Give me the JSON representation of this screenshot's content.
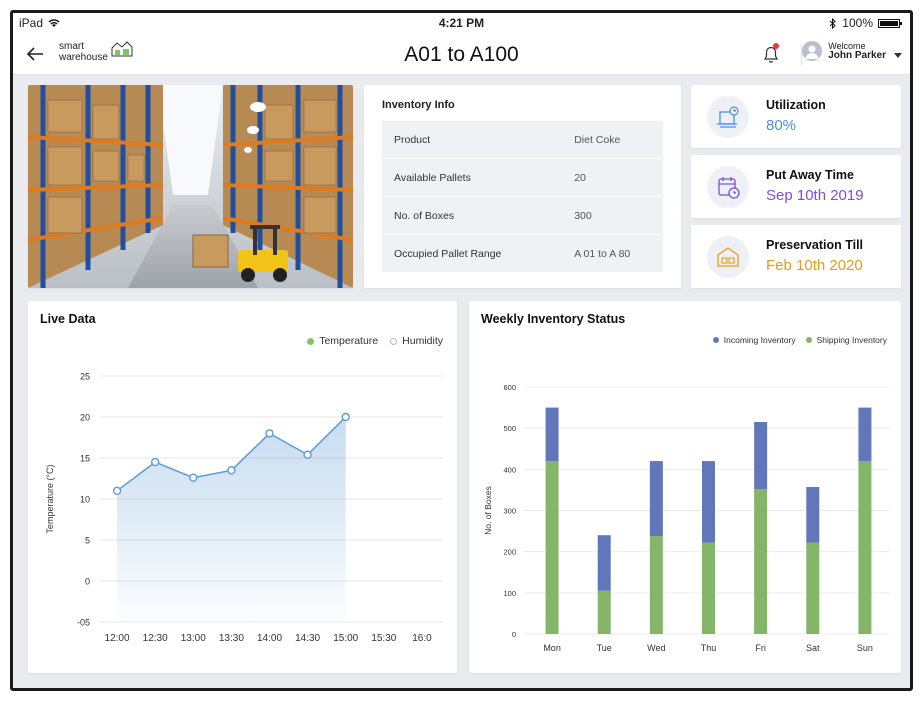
{
  "status_bar": {
    "device": "iPad",
    "time": "4:21 PM",
    "battery": "100%",
    "battery_level": 1.0
  },
  "header": {
    "logo_line1": "smart",
    "logo_line2": "warehouse",
    "title": "A01 to A100",
    "welcome": "Welcome",
    "user_name": "John Parker"
  },
  "inventory": {
    "title": "Inventory Info",
    "rows": [
      {
        "label": "Product",
        "value": "Diet Coke"
      },
      {
        "label": "Available Pallets",
        "value": "20"
      },
      {
        "label": "No. of Boxes",
        "value": "300"
      },
      {
        "label": "Occupied Pallet Range",
        "value": "A 01 to A 80"
      }
    ]
  },
  "stats": [
    {
      "label": "Utilization",
      "value": "80%",
      "color": "#4a90e2",
      "icon": "cart-icon"
    },
    {
      "label": "Put Away Time",
      "value": "Sep 10th 2019",
      "color": "#7b4fd6",
      "icon": "calendar-clock-icon"
    },
    {
      "label": "Preservation Till",
      "value": "Feb 10th 2020",
      "color": "#e59c1c",
      "icon": "warehouse-icon"
    }
  ],
  "live_chart": {
    "title": "Live Data",
    "legend": [
      "Temperature",
      "Humidity"
    ],
    "legend_colors": [
      "#7cc46a",
      "#cfcfcf"
    ],
    "ylabel": "Temperature (°C)",
    "line_color": "#5b9bd5"
  },
  "weekly_chart": {
    "title": "Weekly Inventory Status",
    "legend": [
      "Incoming Inventory",
      "Shipping Inventory"
    ],
    "colors": [
      "#6177b9",
      "#84b569"
    ],
    "ylabel": "No. of Boxes"
  },
  "chart_data": [
    {
      "type": "area",
      "title": "Live Data",
      "ylabel": "Temperature (°C)",
      "x": [
        "12:00",
        "12:30",
        "13:00",
        "13:30",
        "14:00",
        "14:30",
        "15:00",
        "15:30",
        "16:0"
      ],
      "series": [
        {
          "name": "Temperature",
          "values": [
            11,
            14.5,
            12.6,
            13.5,
            18,
            15.4,
            20
          ]
        }
      ],
      "ylim": [
        -5,
        25
      ],
      "yticks": [
        25,
        20,
        15,
        10,
        5,
        0,
        -5
      ],
      "ytick_labels": [
        "25",
        "20",
        "15",
        "10",
        "5",
        "0",
        "-05"
      ],
      "grid": true
    },
    {
      "type": "bar",
      "stacked": true,
      "title": "Weekly Inventory Status",
      "ylabel": "No. of Boxes",
      "categories": [
        "Mon",
        "Tue",
        "Wed",
        "Thu",
        "Fri",
        "Sat",
        "Sun"
      ],
      "series": [
        {
          "name": "Shipping Inventory",
          "values": [
            420,
            105,
            238,
            222,
            352,
            222,
            420
          ]
        },
        {
          "name": "Incoming Inventory",
          "values": [
            130,
            135,
            182,
            198,
            163,
            135,
            130
          ]
        }
      ],
      "ylim": [
        0,
        600
      ],
      "yticks": [
        0,
        100,
        200,
        300,
        400,
        500,
        600
      ],
      "grid": true
    }
  ]
}
